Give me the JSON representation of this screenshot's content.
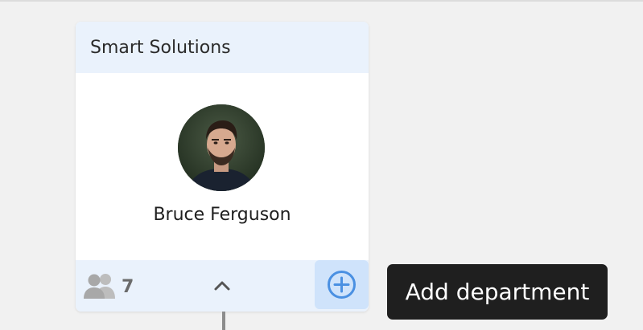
{
  "card": {
    "title": "Smart Solutions",
    "person_name": "Bruce Ferguson",
    "member_count": "7"
  },
  "tooltip": {
    "text": "Add department"
  },
  "icons": {
    "members": "people-icon",
    "collapse": "chevron-up-icon",
    "add": "plus-circle-icon"
  },
  "colors": {
    "header_bg": "#eaf2fc",
    "add_button_bg": "#cfe3fb",
    "accent": "#4a90e2",
    "tooltip_bg": "#1f1f1f"
  }
}
